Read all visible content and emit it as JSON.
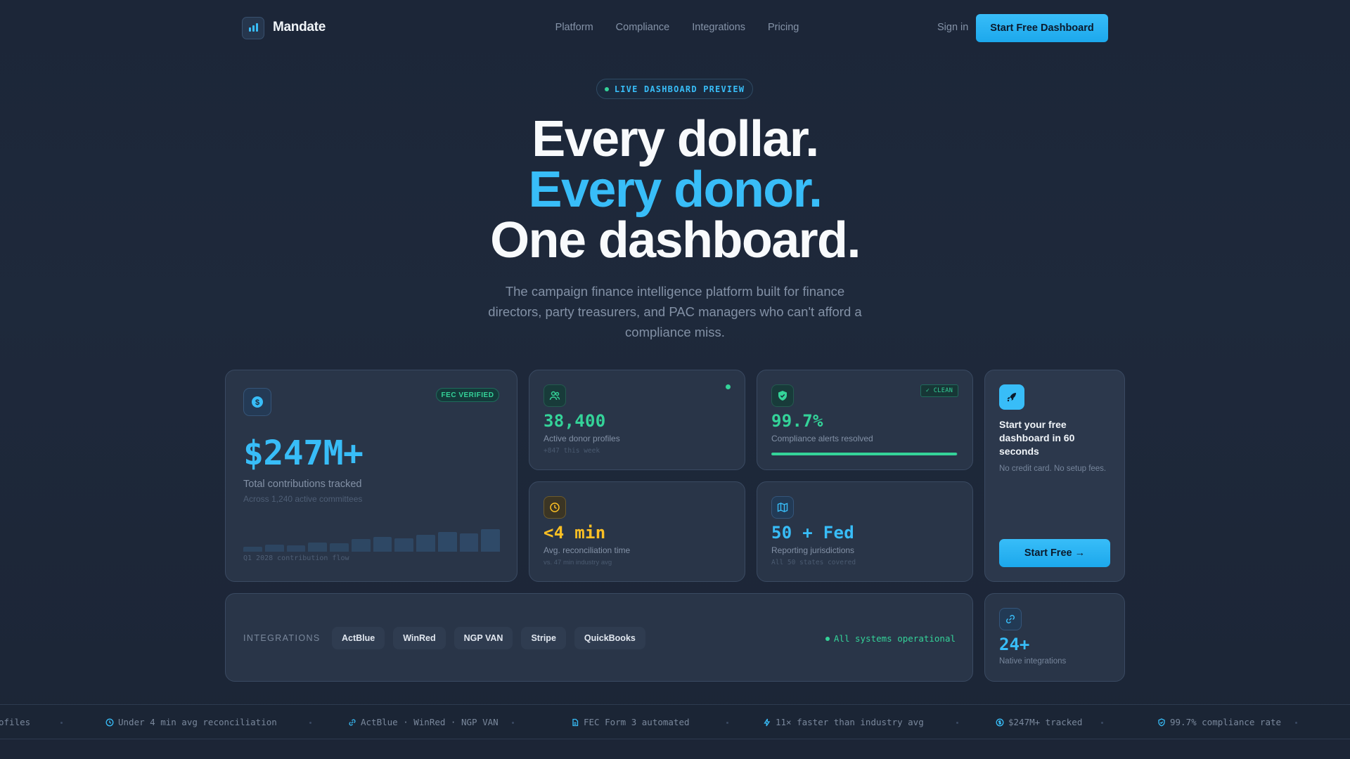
{
  "brand": {
    "name": "Mandate"
  },
  "nav": {
    "links": [
      "Platform",
      "Compliance",
      "Integrations",
      "Pricing"
    ],
    "sign_in": "Sign in",
    "cta": "Start Free Dashboard"
  },
  "hero": {
    "badge": "LIVE DASHBOARD PREVIEW",
    "line1": "Every dollar.",
    "line2": "Every donor.",
    "line3": "One dashboard.",
    "subtitle": "The campaign finance intelligence platform built for finance directors, party treasurers, and PAC managers who can't afford a compliance miss."
  },
  "cards": {
    "contributions": {
      "badge": "FEC VERIFIED",
      "value": "$247M+",
      "label": "Total contributions tracked",
      "sublabel": "Across 1,240 active committees",
      "caption": "Q1 2028 contribution flow",
      "bar_levels": [
        0.22,
        0.3,
        0.28,
        0.42,
        0.36,
        0.55,
        0.65,
        0.58,
        0.75,
        0.88,
        0.82,
        1.0
      ]
    },
    "donors": {
      "value": "38,400",
      "label": "Active donor profiles",
      "sublabel": "+847 this week"
    },
    "compliance": {
      "badge": "✓ CLEAN",
      "value": "99.7%",
      "label": "Compliance alerts resolved",
      "progress": 0.997
    },
    "reconciliation": {
      "value": "<4 min",
      "label": "Avg. reconciliation time",
      "sublabel": "vs. 47 min industry avg"
    },
    "jurisdictions": {
      "value": "50 + Fed",
      "label": "Reporting jurisdictions",
      "sublabel": "All 50 states covered"
    },
    "start": {
      "title": "Start your free dashboard in 60 seconds",
      "desc": "No credit card. No setup fees.",
      "button": "Start Free →"
    },
    "integrations": {
      "label": "INTEGRATIONS",
      "chips": [
        "ActBlue",
        "WinRed",
        "NGP VAN",
        "Stripe",
        "QuickBooks"
      ],
      "status": "All systems operational"
    },
    "native": {
      "value": "24+",
      "label": "Native integrations"
    }
  },
  "ticker": {
    "items": [
      "ofiles",
      "Under 4 min avg reconciliation",
      "ActBlue · WinRed · NGP VAN",
      "FEC Form 3 automated",
      "11× faster than industry avg",
      "$247M+ tracked",
      "99.7% compliance rate"
    ]
  },
  "colors": {
    "background": "#1e293b",
    "accent": "#38bdf8",
    "success": "#34d399",
    "warning": "#fbbf24",
    "card": "#293548"
  }
}
